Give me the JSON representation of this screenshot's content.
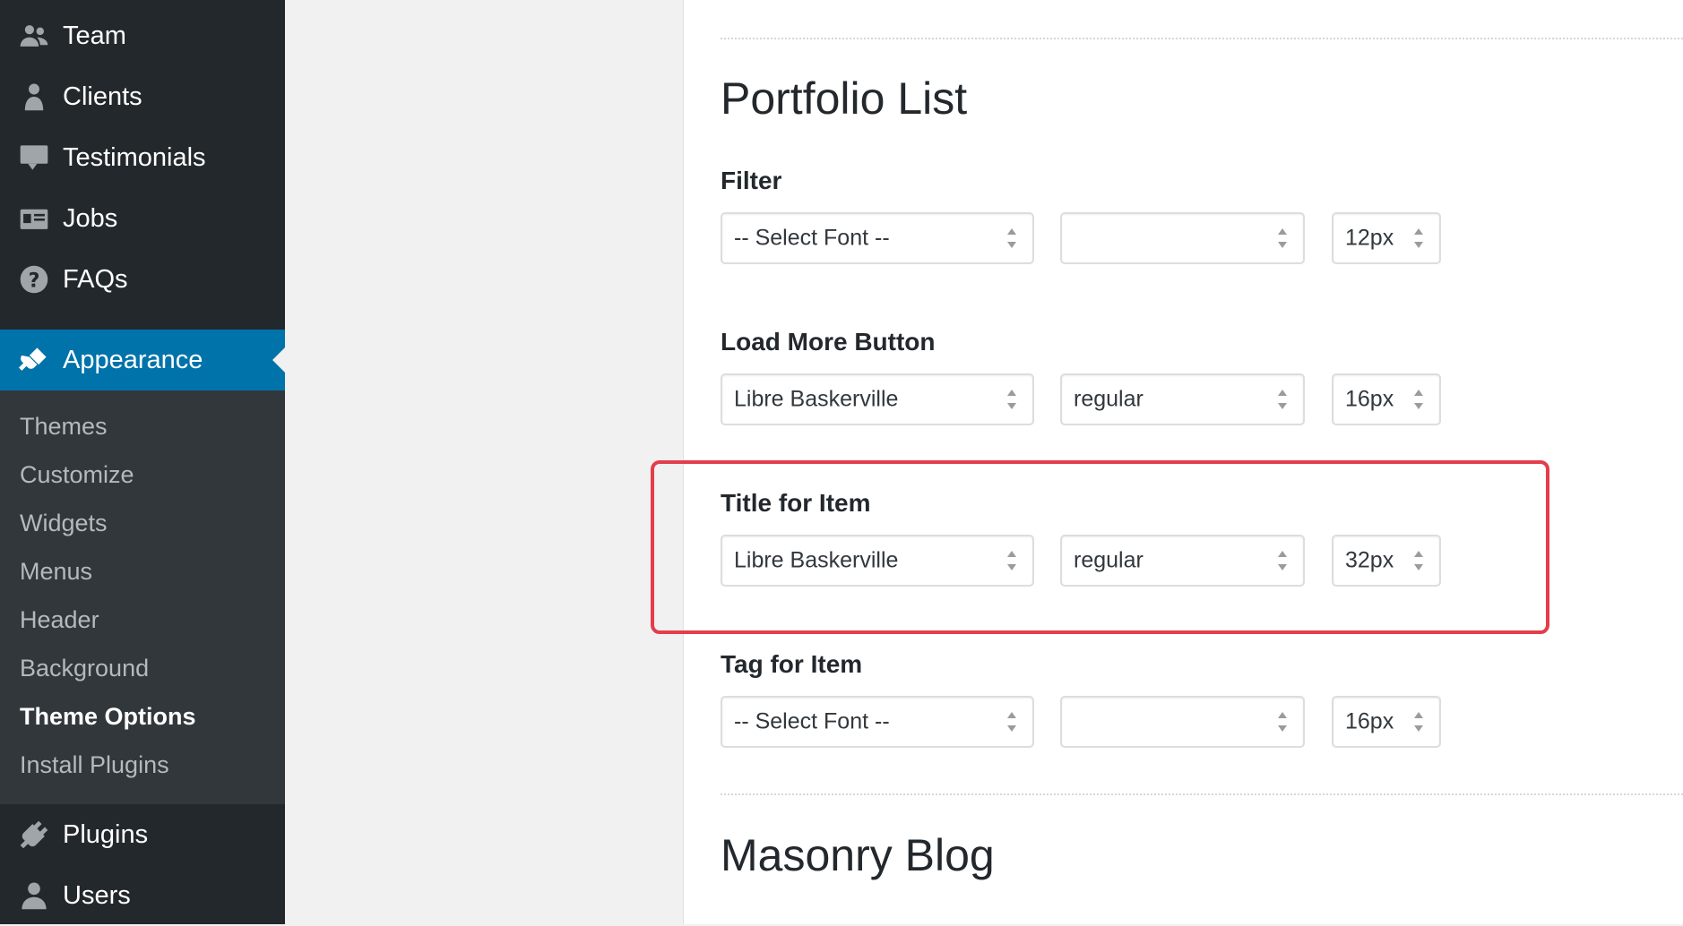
{
  "sidebar": {
    "top_items": [
      {
        "label": "Team",
        "icon": "team-icon"
      },
      {
        "label": "Clients",
        "icon": "clients-icon"
      },
      {
        "label": "Testimonials",
        "icon": "testimonials-icon"
      },
      {
        "label": "Jobs",
        "icon": "jobs-icon"
      },
      {
        "label": "FAQs",
        "icon": "faqs-icon"
      }
    ],
    "current": {
      "label": "Appearance",
      "icon": "paintbrush-icon"
    },
    "submenu": [
      "Themes",
      "Customize",
      "Widgets",
      "Menus",
      "Header",
      "Background",
      "Theme Options",
      "Install Plugins"
    ],
    "submenu_active": "Theme Options",
    "bottom_items": [
      {
        "label": "Plugins",
        "icon": "plugin-icon"
      },
      {
        "label": "Users",
        "icon": "users-icon"
      }
    ],
    "colors": {
      "background": "#23282d",
      "current": "#0073aa",
      "submenu_bg": "#32373c"
    }
  },
  "main": {
    "section_title": "Portfolio List",
    "next_section_title": "Masonry Blog",
    "fields": [
      {
        "label": "Filter",
        "font": "-- Select Font --",
        "weight": "",
        "size": "12px"
      },
      {
        "label": "Load More Button",
        "font": "Libre Baskerville",
        "weight": "regular",
        "size": "16px"
      },
      {
        "label": "Title for Item",
        "font": "Libre Baskerville",
        "weight": "regular",
        "size": "32px",
        "highlighted": true
      },
      {
        "label": "Tag for Item",
        "font": "-- Select Font --",
        "weight": "",
        "size": "16px"
      }
    ],
    "highlight_color": "#e43d4b"
  }
}
